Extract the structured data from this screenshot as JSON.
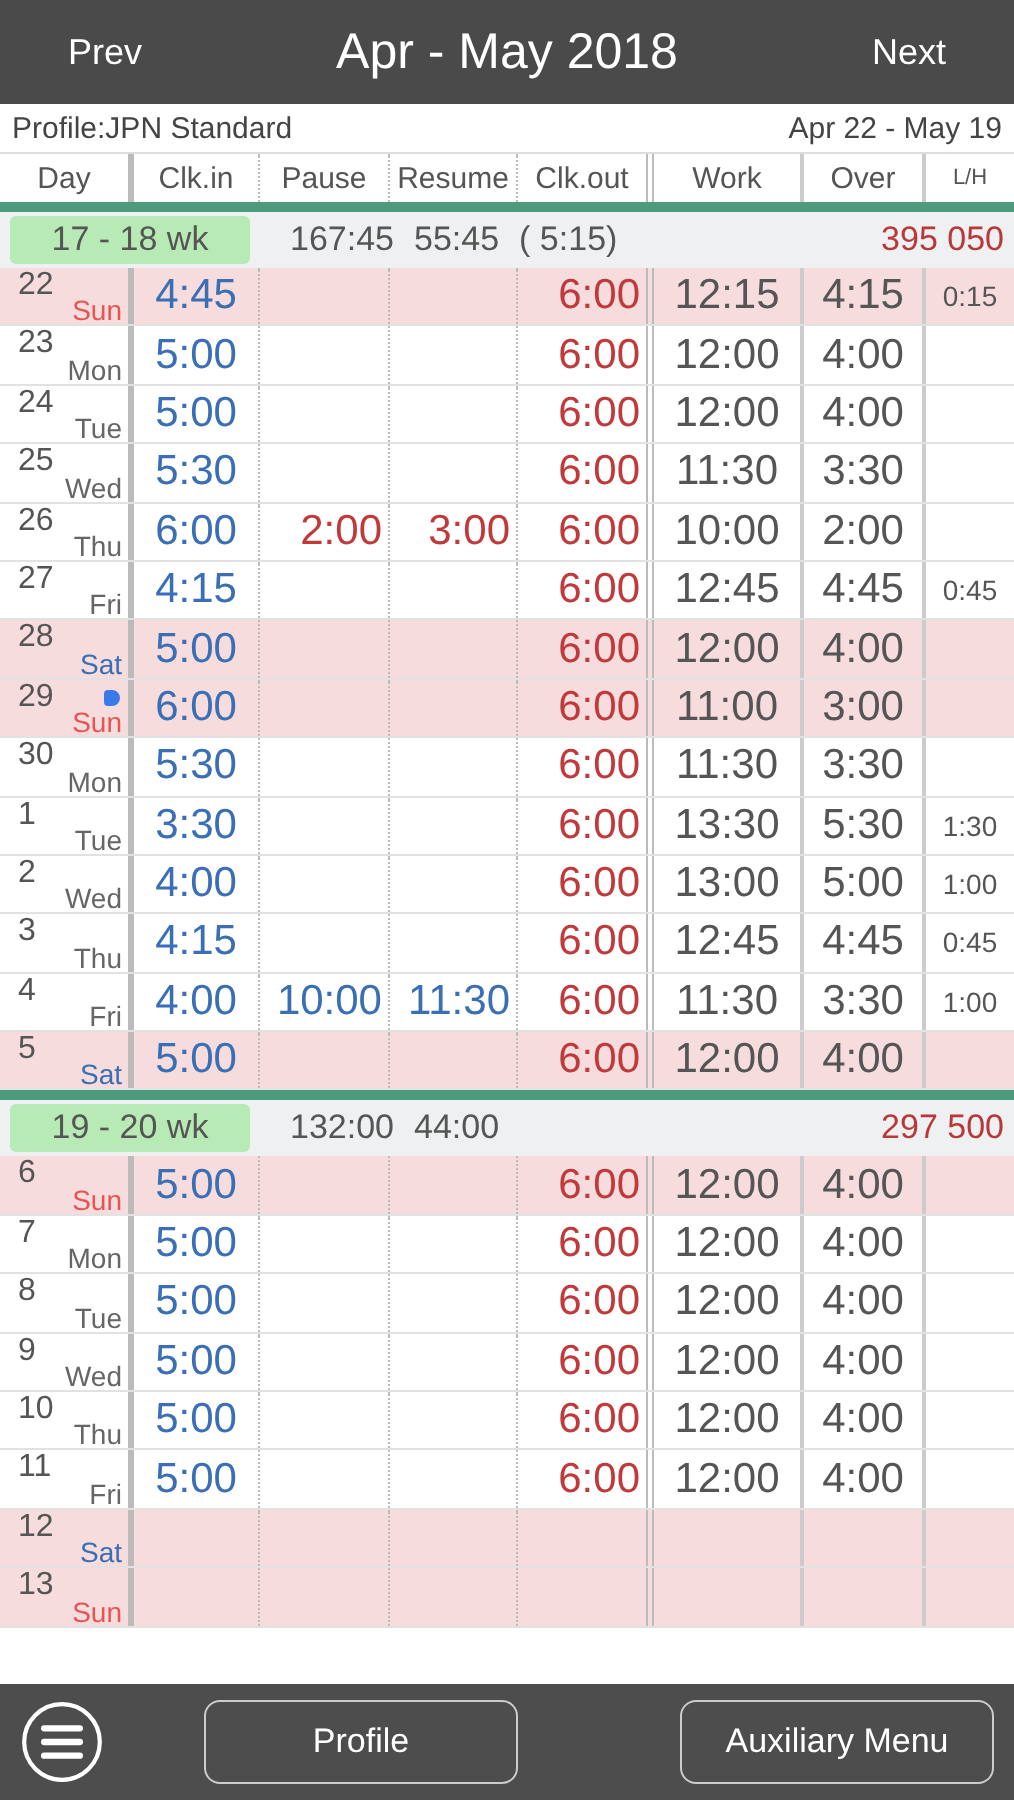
{
  "header": {
    "prev": "Prev",
    "title": "Apr - May 2018",
    "next": "Next"
  },
  "profile": {
    "label": "Profile:JPN Standard",
    "range": "Apr 22 - May 19"
  },
  "columns": [
    "Day",
    "Clk.in",
    "Pause",
    "Resume",
    "Clk.out",
    "Work",
    "Over",
    "L/H"
  ],
  "weeks": [
    {
      "label": "17 - 18 wk",
      "totals": [
        "167:45",
        "55:45",
        "( 5:15)"
      ],
      "amount": "395 050",
      "days": [
        {
          "day": "22",
          "weekday": "Sun",
          "kind": "sun",
          "clock_in": "4:45",
          "clock_out": "6:00",
          "work": "12:15",
          "over": "4:15",
          "lh": "0:15"
        },
        {
          "day": "23",
          "weekday": "Mon",
          "kind": "weekday",
          "clock_in": "5:00",
          "clock_out": "6:00",
          "work": "12:00",
          "over": "4:00"
        },
        {
          "day": "24",
          "weekday": "Tue",
          "kind": "weekday",
          "clock_in": "5:00",
          "clock_out": "6:00",
          "work": "12:00",
          "over": "4:00"
        },
        {
          "day": "25",
          "weekday": "Wed",
          "kind": "weekday",
          "clock_in": "5:30",
          "clock_out": "6:00",
          "work": "11:30",
          "over": "3:30"
        },
        {
          "day": "26",
          "weekday": "Thu",
          "kind": "weekday",
          "clock_in": "6:00",
          "pause": {
            "text": "2:00",
            "pm": true
          },
          "resume": {
            "text": "3:00",
            "pm": true
          },
          "clock_out": "6:00",
          "work": "10:00",
          "over": "2:00"
        },
        {
          "day": "27",
          "weekday": "Fri",
          "kind": "weekday",
          "clock_in": "4:15",
          "clock_out": "6:00",
          "work": "12:45",
          "over": "4:45",
          "lh": "0:45"
        },
        {
          "day": "28",
          "weekday": "Sat",
          "kind": "sat",
          "clock_in": "5:00",
          "clock_out": "6:00",
          "work": "12:00",
          "over": "4:00"
        },
        {
          "day": "29",
          "weekday": "Sun",
          "kind": "sun",
          "note": true,
          "clock_in": "6:00",
          "clock_out": "6:00",
          "work": "11:00",
          "over": "3:00"
        },
        {
          "day": "30",
          "weekday": "Mon",
          "kind": "weekday",
          "clock_in": "5:30",
          "clock_out": "6:00",
          "work": "11:30",
          "over": "3:30"
        },
        {
          "day": "1",
          "weekday": "Tue",
          "kind": "weekday",
          "clock_in": "3:30",
          "clock_out": "6:00",
          "work": "13:30",
          "over": "5:30",
          "lh": "1:30"
        },
        {
          "day": "2",
          "weekday": "Wed",
          "kind": "weekday",
          "clock_in": "4:00",
          "clock_out": "6:00",
          "work": "13:00",
          "over": "5:00",
          "lh": "1:00"
        },
        {
          "day": "3",
          "weekday": "Thu",
          "kind": "weekday",
          "clock_in": "4:15",
          "clock_out": "6:00",
          "work": "12:45",
          "over": "4:45",
          "lh": "0:45"
        },
        {
          "day": "4",
          "weekday": "Fri",
          "kind": "weekday",
          "clock_in": "4:00",
          "pause": {
            "text": "10:00",
            "pm": false
          },
          "resume": {
            "text": "11:30",
            "pm": false
          },
          "clock_out": "6:00",
          "work": "11:30",
          "over": "3:30",
          "lh": "1:00"
        },
        {
          "day": "5",
          "weekday": "Sat",
          "kind": "sat",
          "clock_in": "5:00",
          "clock_out": "6:00",
          "work": "12:00",
          "over": "4:00"
        }
      ]
    },
    {
      "label": "19 - 20 wk",
      "totals": [
        "132:00",
        "44:00"
      ],
      "amount": "297 500",
      "days": [
        {
          "day": "6",
          "weekday": "Sun",
          "kind": "sun",
          "clock_in": "5:00",
          "clock_out": "6:00",
          "work": "12:00",
          "over": "4:00"
        },
        {
          "day": "7",
          "weekday": "Mon",
          "kind": "weekday",
          "clock_in": "5:00",
          "clock_out": "6:00",
          "work": "12:00",
          "over": "4:00"
        },
        {
          "day": "8",
          "weekday": "Tue",
          "kind": "weekday",
          "clock_in": "5:00",
          "clock_out": "6:00",
          "work": "12:00",
          "over": "4:00"
        },
        {
          "day": "9",
          "weekday": "Wed",
          "kind": "weekday",
          "clock_in": "5:00",
          "clock_out": "6:00",
          "work": "12:00",
          "over": "4:00"
        },
        {
          "day": "10",
          "weekday": "Thu",
          "kind": "weekday",
          "clock_in": "5:00",
          "clock_out": "6:00",
          "work": "12:00",
          "over": "4:00"
        },
        {
          "day": "11",
          "weekday": "Fri",
          "kind": "weekday",
          "clock_in": "5:00",
          "clock_out": "6:00",
          "work": "12:00",
          "over": "4:00"
        },
        {
          "day": "12",
          "weekday": "Sat",
          "kind": "sat"
        },
        {
          "day": "13",
          "weekday": "Sun",
          "kind": "sun"
        }
      ]
    }
  ],
  "footer": {
    "profile_button": "Profile",
    "aux_button": "Auxiliary Menu"
  }
}
